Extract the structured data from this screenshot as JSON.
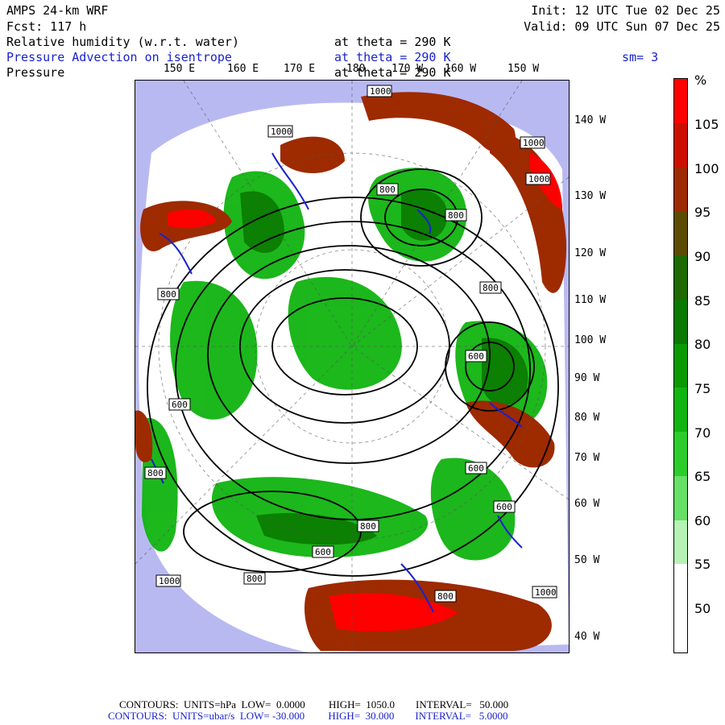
{
  "header": {
    "model": "AMPS 24-km WRF",
    "forecast": "Fcst: 117 h",
    "init": "Init: 12 UTC Tue 02 Dec 25",
    "valid": "Valid: 09 UTC Sun 07 Dec 25",
    "fields": [
      {
        "name": "Relative humidity (w.r.t. water)",
        "level": "at theta = 290 K",
        "color": "#000000"
      },
      {
        "name": "Pressure Advection on isentrope",
        "level": "at theta = 290 K",
        "color": "#1a22cc",
        "extra": "sm= 3"
      },
      {
        "name": "Pressure",
        "level": "at theta = 290 K",
        "color": "#000000"
      }
    ]
  },
  "map": {
    "top_longitudes": [
      "150 E",
      "160 E",
      "170 E",
      "180",
      "170 W",
      "160 W",
      "150 W"
    ],
    "right_longitudes": [
      "140 W",
      "130 W",
      "120 W",
      "110 W",
      "100 W",
      "90 W",
      "80 W",
      "70 W",
      "60 W",
      "50 W",
      "40 W"
    ],
    "contour_labels": [
      "1000",
      "1000",
      "800",
      "800",
      "1000",
      "1000",
      "800",
      "800",
      "600",
      "600",
      "600",
      "800",
      "600",
      "800",
      "600",
      "800",
      "800",
      "1000",
      "1000",
      "800",
      "600"
    ]
  },
  "colorbar": {
    "unit": "%",
    "labels": [
      "105",
      "100",
      "95",
      "90",
      "85",
      "80",
      "75",
      "70",
      "65",
      "60",
      "55",
      "50"
    ],
    "colors": [
      "#ff0000",
      "#cc1000",
      "#9e2a00",
      "#5c4c00",
      "#1e6a00",
      "#0a7a00",
      "#0a9a00",
      "#10b410",
      "#2ccc2c",
      "#66e066",
      "#b6f2b6",
      "#ffffff",
      "#ffffff"
    ]
  },
  "footer": {
    "line1": "CONTOURS:  UNITS=hPa  LOW=  0.0000         HIGH=  1050.0        INTERVAL=   50.000",
    "line2": "CONTOURS:  UNITS=ubar/s  LOW= -30.000         HIGH=  30.000        INTERVAL=   5.0000",
    "line2_color": "#1a22cc"
  }
}
